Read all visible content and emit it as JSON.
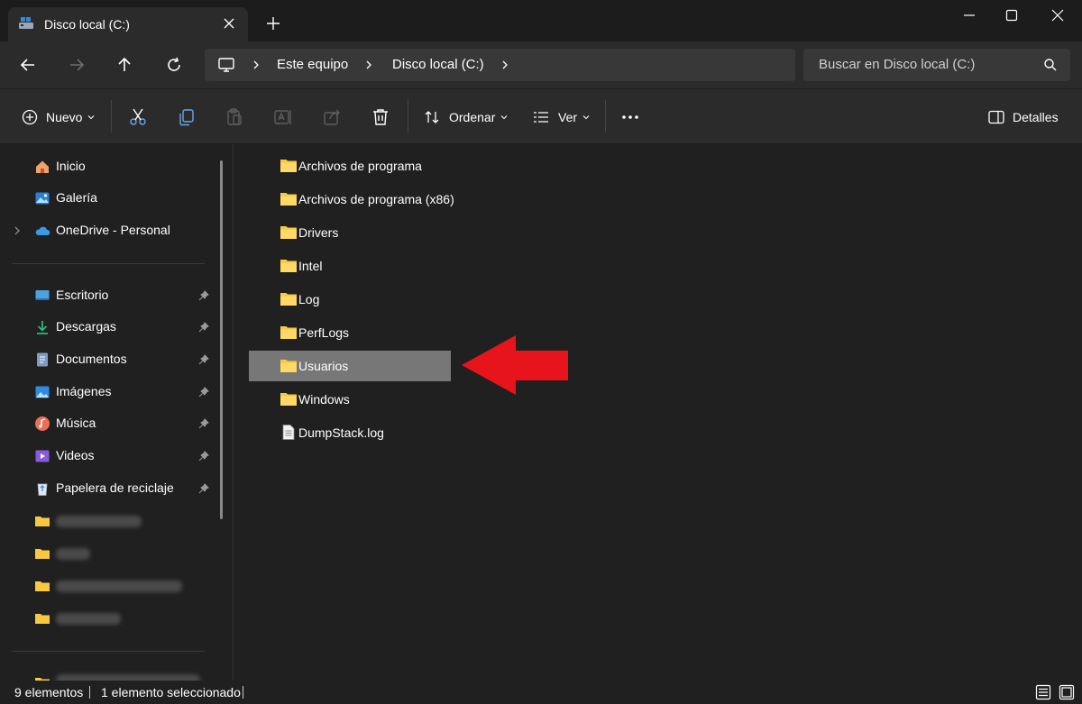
{
  "window": {
    "tab_title": "Disco local (C:)",
    "tab_icon": "drive-icon"
  },
  "navbar": {
    "breadcrumbs": [
      "Este equipo",
      "Disco local (C:)"
    ],
    "search_placeholder": "Buscar en Disco local (C:)"
  },
  "toolbar": {
    "new_label": "Nuevo",
    "sort_label": "Ordenar",
    "view_label": "Ver",
    "details_label": "Detalles"
  },
  "sidebar": {
    "top_items": [
      {
        "label": "Inicio",
        "icon": "home-icon"
      },
      {
        "label": "Galería",
        "icon": "gallery-icon"
      },
      {
        "label": "OneDrive - Personal",
        "icon": "cloud-icon"
      }
    ],
    "pinned_items": [
      {
        "label": "Escritorio",
        "icon": "desktop-icon"
      },
      {
        "label": "Descargas",
        "icon": "download-icon"
      },
      {
        "label": "Documentos",
        "icon": "document-icon"
      },
      {
        "label": "Imágenes",
        "icon": "image-icon"
      },
      {
        "label": "Música",
        "icon": "music-icon"
      },
      {
        "label": "Videos",
        "icon": "video-icon"
      },
      {
        "label": "Papelera de reciclaje",
        "icon": "recycle-bin-icon"
      }
    ]
  },
  "files": [
    {
      "name": "Archivos de programa",
      "type": "folder"
    },
    {
      "name": "Archivos de programa (x86)",
      "type": "folder"
    },
    {
      "name": "Drivers",
      "type": "folder"
    },
    {
      "name": "Intel",
      "type": "folder"
    },
    {
      "name": "Log",
      "type": "folder"
    },
    {
      "name": "PerfLogs",
      "type": "folder"
    },
    {
      "name": "Usuarios",
      "type": "folder",
      "selected": true
    },
    {
      "name": "Windows",
      "type": "folder"
    },
    {
      "name": "DumpStack.log",
      "type": "file"
    }
  ],
  "status": {
    "item_count": "9 elementos",
    "selection": "1 elemento seleccionado"
  },
  "colors": {
    "folder": "#f8c840",
    "annotation_arrow": "#e8141c",
    "selection": "#777777"
  }
}
